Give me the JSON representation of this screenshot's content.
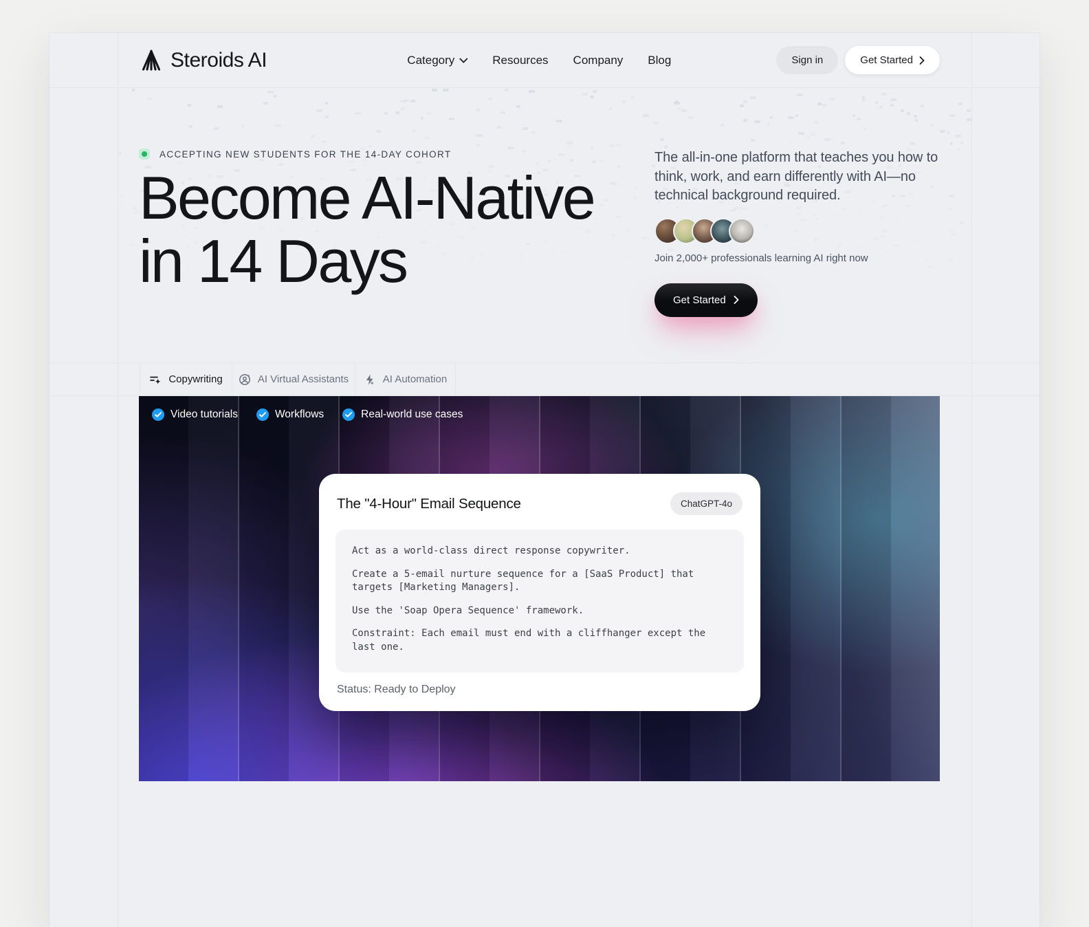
{
  "brand": {
    "name": "Steroids AI"
  },
  "nav": {
    "items": [
      "Category",
      "Resources",
      "Company",
      "Blog"
    ]
  },
  "header": {
    "sign_in": "Sign in",
    "get_started": "Get Started"
  },
  "hero": {
    "badge": "ACCEPTING NEW STUDENTS FOR THE 14-DAY COHORT",
    "title_line1": "Become AI-Native",
    "title_line2": "in 14 Days",
    "description": "The all-in-one platform that teaches you how to think, work, and earn differently with AI—no technical background required.",
    "social_proof": "Join 2,000+ professionals learning AI right now",
    "cta": "Get Started",
    "avatar_count": 5
  },
  "tabs": [
    {
      "label": "Copywriting",
      "icon": "pen-sparkle-icon",
      "active": true
    },
    {
      "label": "AI Virtual Assistants",
      "icon": "assistant-icon",
      "active": false
    },
    {
      "label": "AI Automation",
      "icon": "bolt-icon",
      "active": false
    }
  ],
  "features": [
    "Video tutorials",
    "Workflows",
    "Real-world use cases"
  ],
  "card": {
    "title": "The \"4-Hour\" Email Sequence",
    "model_badge": "ChatGPT-4o",
    "prompt": [
      "Act as a world-class direct response copywriter.",
      "Create a 5-email nurture sequence for a [SaaS Product] that targets [Marketing Managers].",
      "Use the 'Soap Opera Sequence' framework.",
      "Constraint: Each email must end with a cliffhanger except the last one."
    ],
    "status": "Status: Ready to Deploy"
  },
  "colors": {
    "page_surface": "#edeff3",
    "badge_green": "#27b567",
    "check_blue": "#1f9cf0",
    "cta_glow_pink": "#ee6096",
    "cta_dark": "#0b0c0f",
    "image_navy": "#0b0c1a",
    "image_magenta": "#c64ade",
    "image_blue": "#4848e1"
  }
}
